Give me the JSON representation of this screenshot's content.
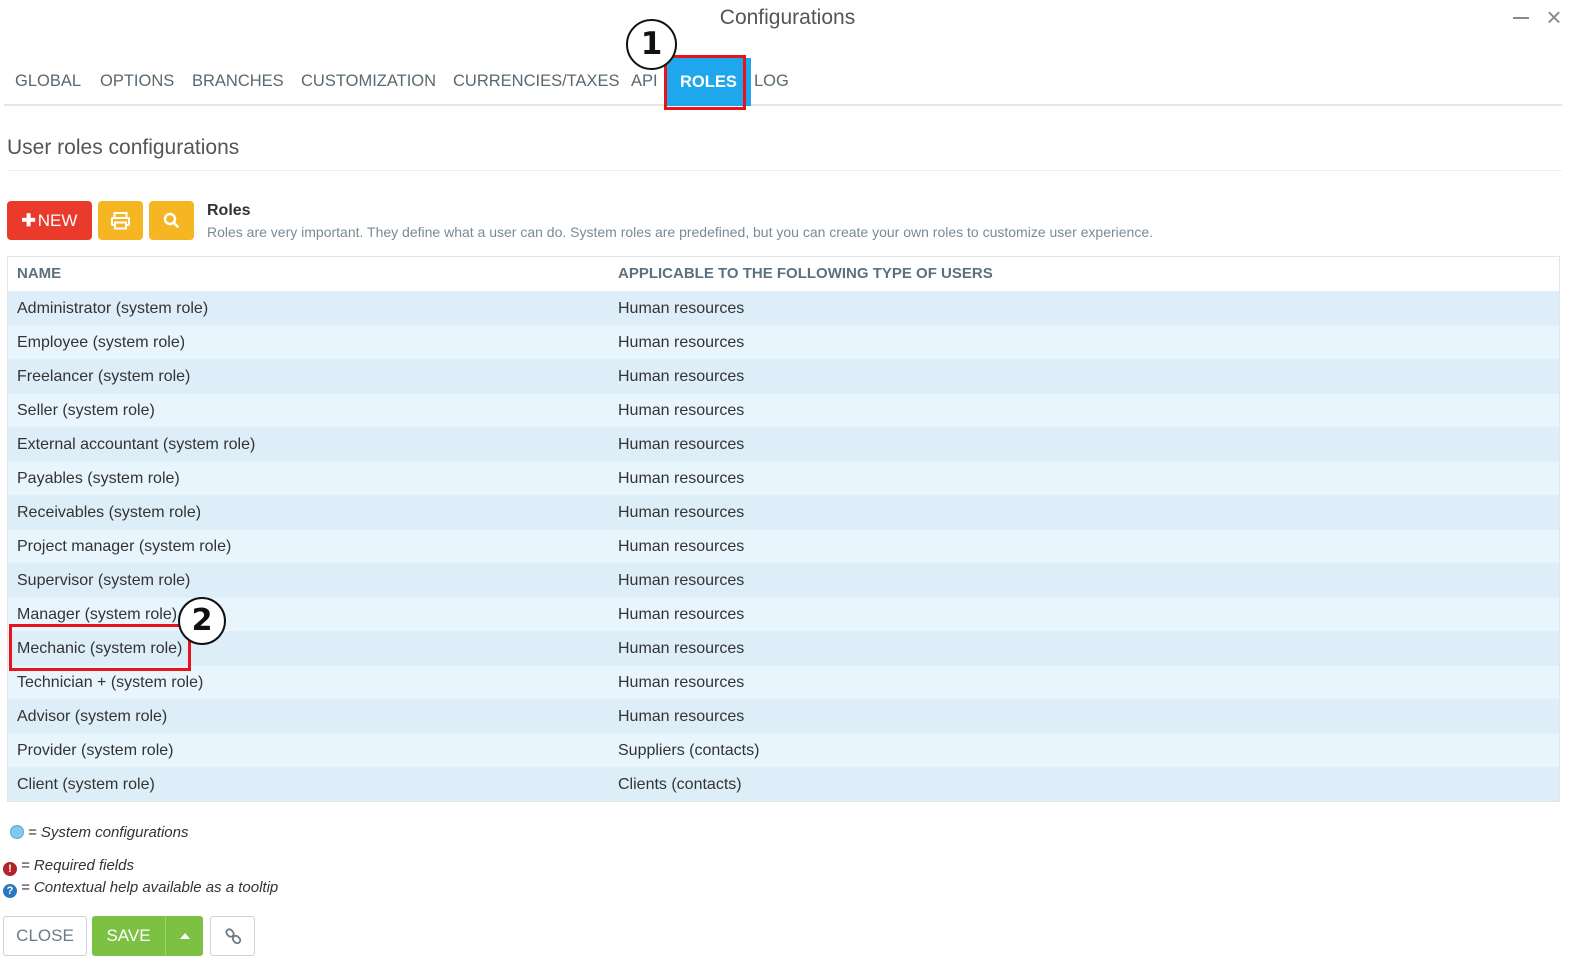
{
  "window": {
    "title": "Configurations"
  },
  "tabs": [
    {
      "label": "GLOBAL"
    },
    {
      "label": "OPTIONS"
    },
    {
      "label": "BRANCHES"
    },
    {
      "label": "CUSTOMIZATION"
    },
    {
      "label": "CURRENCIES/TAXES"
    },
    {
      "label": "API"
    },
    {
      "label": "ROLES",
      "active": true
    },
    {
      "label": "LOG"
    }
  ],
  "annotations": {
    "badge1": "1",
    "badge2": "2",
    "highlight_color": "#e8141b"
  },
  "section": {
    "title": "User roles configurations"
  },
  "toolbar": {
    "new_label": "NEW",
    "new_icon": "plus-icon",
    "print_icon": "print-icon",
    "search_icon": "search-icon"
  },
  "roles_info": {
    "heading": "Roles",
    "description": "Roles are very important. They define what a user can do. System roles are predefined, but you can create your own roles to customize user experience."
  },
  "table": {
    "headers": [
      "NAME",
      "APPLICABLE TO THE FOLLOWING TYPE OF USERS"
    ],
    "rows": [
      {
        "name": "Administrator (system role)",
        "applicable": "Human resources"
      },
      {
        "name": "Employee (system role)",
        "applicable": "Human resources"
      },
      {
        "name": "Freelancer (system role)",
        "applicable": "Human resources"
      },
      {
        "name": "Seller (system role)",
        "applicable": "Human resources"
      },
      {
        "name": "External accountant (system role)",
        "applicable": "Human resources"
      },
      {
        "name": "Payables (system role)",
        "applicable": "Human resources"
      },
      {
        "name": "Receivables (system role)",
        "applicable": "Human resources"
      },
      {
        "name": "Project manager (system role)",
        "applicable": "Human resources"
      },
      {
        "name": "Supervisor (system role)",
        "applicable": "Human resources"
      },
      {
        "name": "Manager (system role)",
        "applicable": "Human resources"
      },
      {
        "name": "Mechanic (system role)",
        "applicable": "Human resources"
      },
      {
        "name": "Technician + (system role)",
        "applicable": "Human resources"
      },
      {
        "name": "Advisor (system role)",
        "applicable": "Human resources"
      },
      {
        "name": "Provider (system role)",
        "applicable": "Suppliers (contacts)"
      },
      {
        "name": "Client (system role)",
        "applicable": "Clients (contacts)"
      }
    ]
  },
  "legend": {
    "system": "= System configurations",
    "required": "= Required fields",
    "help": "= Contextual help available as a tooltip"
  },
  "footer": {
    "close_label": "CLOSE",
    "save_label": "SAVE",
    "link_icon": "link-icon"
  },
  "colors": {
    "accent": "#1ea7ec",
    "new_button": "#e93a2c",
    "tool_button": "#f6b623",
    "save_button": "#7cc142"
  }
}
